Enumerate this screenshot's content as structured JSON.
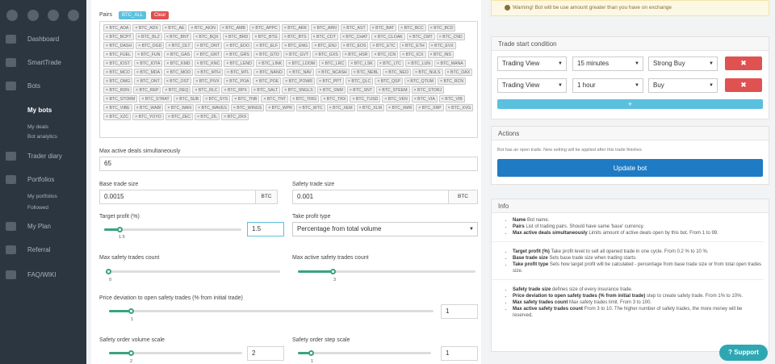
{
  "sidebar": {
    "social": [
      "twitter-icon",
      "telegram-icon",
      "apple-icon",
      "android-icon"
    ],
    "items": [
      {
        "label": "Dashboard",
        "icon": "dashboard-icon"
      },
      {
        "label": "SmartTrade",
        "icon": "smarttrade-icon"
      },
      {
        "label": "Bots",
        "icon": "bots-icon"
      },
      {
        "label": "My bots",
        "icon": ""
      },
      {
        "label": "Trader diary",
        "icon": "diary-icon"
      },
      {
        "label": "Portfolios",
        "icon": "portfolios-icon"
      },
      {
        "label": "My Plan",
        "icon": "plan-icon"
      },
      {
        "label": "Referral",
        "icon": "referral-icon"
      },
      {
        "label": "FAQ/WIKI",
        "icon": "faq-icon"
      }
    ],
    "subitems": {
      "my_deals": "My deals",
      "bot_analytics": "Bot analytics",
      "my_portfolios": "My portfolios",
      "followed": "Followed"
    }
  },
  "pairs_section": {
    "label": "Pairs",
    "btc_all": "BTC_ALL",
    "clear": "Clear",
    "pairs": [
      "BTC_ADA",
      "BTC_ADX",
      "BTC_AE",
      "BTC_AION",
      "BTC_AMB",
      "BTC_APPC",
      "BTC_ARK",
      "BTC_ARN",
      "BTC_AST",
      "BTC_BAT",
      "BTC_BCC",
      "BTC_BCD",
      "BTC_BCPT",
      "BTC_BLZ",
      "BTC_BNT",
      "BTC_BQX",
      "BTC_BRD",
      "BTC_BTG",
      "BTC_BTS",
      "BTC_CDT",
      "BTC_CHAT",
      "BTC_CLOAK",
      "BTC_CMT",
      "BTC_CND",
      "BTC_DASH",
      "BTC_DGD",
      "BTC_DLT",
      "BTC_DNT",
      "BTC_EDO",
      "BTC_ELF",
      "BTC_ENG",
      "BTC_ENJ",
      "BTC_EOS",
      "BTC_ETC",
      "BTC_ETH",
      "BTC_EVX",
      "BTC_FUEL",
      "BTC_FUN",
      "BTC_GAS",
      "BTC_GNT",
      "BTC_GRS",
      "BTC_GTO",
      "BTC_GVT",
      "BTC_GXS",
      "BTC_HSR",
      "BTC_ICN",
      "BTC_ICX",
      "BTC_INS",
      "BTC_IOST",
      "BTC_IOTA",
      "BTC_KMD",
      "BTC_KNC",
      "BTC_LEND",
      "BTC_LINK",
      "BTC_LOOM",
      "BTC_LRC",
      "BTC_LSK",
      "BTC_LTC",
      "BTC_LUN",
      "BTC_MANA",
      "BTC_MCO",
      "BTC_MDA",
      "BTC_MOD",
      "BTC_MTH",
      "BTC_MTL",
      "BTC_NANO",
      "BTC_NAV",
      "BTC_NCASH",
      "BTC_NEBL",
      "BTC_NEO",
      "BTC_NULS",
      "BTC_OAX",
      "BTC_OMG",
      "BTC_ONT",
      "BTC_OST",
      "BTC_PIVX",
      "BTC_POA",
      "BTC_POE",
      "BTC_POWR",
      "BTC_PPT",
      "BTC_QLC",
      "BTC_QSP",
      "BTC_QTUM",
      "BTC_RCN",
      "BTC_RDN",
      "BTC_REP",
      "BTC_REQ",
      "BTC_RLC",
      "BTC_RPX",
      "BTC_SALT",
      "BTC_SNGLS",
      "BTC_SNM",
      "BTC_SNT",
      "BTC_STEEM",
      "BTC_STORJ",
      "BTC_STORM",
      "BTC_STRAT",
      "BTC_SUB",
      "BTC_SYS",
      "BTC_TNB",
      "BTC_TNT",
      "BTC_TRIG",
      "BTC_TRX",
      "BTC_TUSD",
      "BTC_VEN",
      "BTC_VIA",
      "BTC_VIB",
      "BTC_VIBE",
      "BTC_WABI",
      "BTC_WAN",
      "BTC_WAVES",
      "BTC_WINGS",
      "BTC_WPR",
      "BTC_WTC",
      "BTC_XEM",
      "BTC_XLM",
      "BTC_XMR",
      "BTC_XRP",
      "BTC_XVG",
      "BTC_XZC",
      "BTC_YOYO",
      "BTC_ZEC",
      "BTC_ZIL",
      "BTC_ZRX"
    ]
  },
  "form": {
    "max_deals_label": "Max active deals simultaneously",
    "max_deals_value": "65",
    "base_size_label": "Base trade size",
    "base_size_value": "0.0015",
    "base_unit": "BTC",
    "safety_size_label": "Safety trade size",
    "safety_size_value": "0.001",
    "safety_unit": "BTC",
    "target_profit_label": "Target profit (%)",
    "target_profit_value": "1.5",
    "target_profit_fraction": 0.12,
    "target_profit_slider_label": "1.5",
    "take_profit_type_label": "Take profit type",
    "take_profit_type_value": "Percentage from total volume",
    "max_safety_label": "Max safety trades count",
    "max_safety_value": "0",
    "max_safety_fraction": 0.0,
    "max_active_safety_label": "Max active safety trades count",
    "max_active_safety_value": "3",
    "max_active_safety_fraction": 0.2,
    "deviation_label": "Price deviation to open safety trades (% from initial trade)",
    "deviation_value": "1",
    "deviation_slider_label": "1",
    "deviation_fraction": 0.07,
    "volume_scale_label": "Safety order volume scale",
    "volume_scale_value": "2",
    "volume_scale_slider_label": "2",
    "volume_scale_fraction": 0.17,
    "step_scale_label": "Safety order step scale",
    "step_scale_value": "1",
    "step_scale_slider_label": "1",
    "step_scale_fraction": 0.1
  },
  "warning": {
    "text": "Warning! Bot will be use amount greater than you have on exchange"
  },
  "trade_start": {
    "title": "Trade start condition",
    "rows": [
      {
        "source": "Trading View",
        "interval": "15 minutes",
        "signal": "Strong Buy"
      },
      {
        "source": "Trading View",
        "interval": "1 hour",
        "signal": "Buy"
      }
    ],
    "remove": "✖",
    "add": "+"
  },
  "actions": {
    "title": "Actions",
    "note": "Bot has an open trade. New setting will be applied after this trade finishes",
    "update": "Update bot"
  },
  "info": {
    "title": "Info",
    "groups": [
      [
        [
          "Name",
          "Bot name."
        ],
        [
          "Pairs",
          "List of trading pairs. Should have same 'base' currency."
        ],
        [
          "Max active deals simultaneously",
          "Limits amount of active deals open by this bot. From 1 to 99."
        ]
      ],
      [
        [
          "Target profit (%)",
          "Take profit level to sell all opened trade in one cycle. From 0.2 % to 10 %."
        ],
        [
          "Base trade size",
          "Sets base trade size when trading starts."
        ],
        [
          "Take profit type",
          "Sets how target profit will be calculated - percentage from base trade size or from total open trades size."
        ]
      ],
      [
        [
          "Safety trade size",
          "defines size of every insurance trade."
        ],
        [
          "Price deviation to open safety trades (% from initial trade)",
          "step to create safety trade. From 1% to 10%."
        ],
        [
          "Max safety trades count",
          "Max safety trades limit. From 3 to 100."
        ],
        [
          "Max active safety trades count",
          "From 3 to 10. The higher number of safety trades, the more money will be reserved."
        ]
      ]
    ]
  },
  "support": "Support",
  "colors": {
    "sidebar": "#2b3640",
    "accent_green": "#3aa37e",
    "danger": "#e05151",
    "primary": "#1f7bc4",
    "info": "#5bc0de"
  }
}
